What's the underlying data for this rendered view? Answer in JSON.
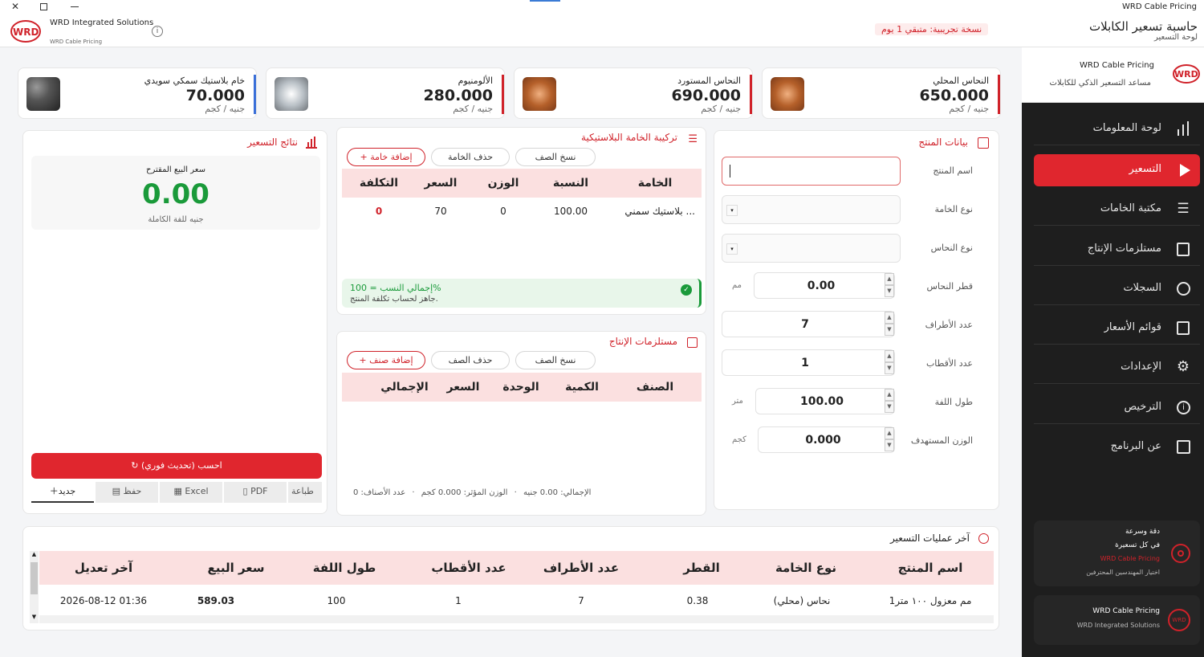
{
  "window": {
    "title": "WRD Cable Pricing"
  },
  "header": {
    "app_title": "حاسبة تسعير الكابلات",
    "app_subtitle": "لوحة التسعير",
    "trial_badge": "نسخة تجريبية: متبقي 1 يوم",
    "company_name": "WRD Integrated Solutions",
    "company_sub": "WRD Cable Pricing",
    "logo_text": "WRD"
  },
  "materials": [
    {
      "name": "النحاس المحلي",
      "price": "650.000",
      "unit": "جنيه / كجم"
    },
    {
      "name": "النحاس المستورد",
      "price": "690.000",
      "unit": "جنيه / كجم"
    },
    {
      "name": "الألومنيوم",
      "price": "280.000",
      "unit": "جنيه / كجم"
    },
    {
      "name": "خام بلاستيك سمكي سويدي",
      "price": "70.000",
      "unit": "جنيه / كجم"
    }
  ],
  "product": {
    "title": "بيانات المنتج",
    "fields": {
      "name_label": "اسم المنتج",
      "name_value": "",
      "material_label": "نوع الخامة",
      "copper_label": "نوع النحاس",
      "diameter_label": "قطر النحاس",
      "diameter_value": "0.00",
      "diameter_unit": "مم",
      "ends_label": "عدد الأطراف",
      "ends_value": "7",
      "poles_label": "عدد الأقطاب",
      "poles_value": "1",
      "length_label": "طول اللفة",
      "length_value": "100.00",
      "length_unit": "متر",
      "weight_label": "الوزن المستهدف",
      "weight_value": "0.000",
      "weight_unit": "كجم"
    }
  },
  "plastic": {
    "title": "تركيبة الخامة البلاستيكية",
    "btn_copy": "نسخ الصف",
    "btn_delete": "حذف الخامة",
    "btn_add": "+ إضافة خامة",
    "headers": [
      "الخامة",
      "النسبة",
      "الوزن",
      "السعر",
      "التكلفة"
    ],
    "rows": [
      [
        "بلاستيك سمني ...",
        "100.00",
        "0",
        "70",
        "0"
      ]
    ],
    "status_title": "إجمالي النسب = 100%",
    "status_sub": "جاهز لحساب تكلفة المنتج."
  },
  "supplies": {
    "title": "مستلزمات الإنتاج",
    "btn_copy": "نسخ الصف",
    "btn_delete": "حذف الصف",
    "btn_add": "+ إضافة صنف",
    "headers": [
      "الصنف",
      "الكمية",
      "الوحدة",
      "السعر",
      "الإجمالي"
    ],
    "footer_count": "عدد الأصناف: 0",
    "footer_weight": "الوزن المؤثر: 0.000 كجم",
    "footer_total": "الإجمالي: 0.00 جنيه",
    "sep": "·"
  },
  "results": {
    "title": "نتائج التسعير",
    "price_label": "سعر البيع المقترح",
    "price_value": "0.00",
    "price_unit": "جنيه للفة الكاملة",
    "calc_btn": "احسب (تحديث فوري)",
    "tabs": [
      "جديد",
      "حفظ",
      "Excel",
      "PDF",
      "طباعة"
    ]
  },
  "recent": {
    "title": "آخر عمليات التسعير",
    "headers": [
      "اسم المنتج",
      "نوع الخامة",
      "القطر",
      "عدد الأطراف",
      "عدد الأقطاب",
      "طول اللفة",
      "سعر البيع",
      "آخر تعديل"
    ],
    "rows": [
      [
        "1مم معزول ١٠٠ متر",
        "نحاس (محلي)",
        "0.38",
        "7",
        "1",
        "100",
        "589.03",
        "2026-08-12 01:36"
      ]
    ]
  },
  "sidebar": {
    "brand": "WRD Cable Pricing",
    "brand_sub": "مساعد التسعير الذكي للكابلات",
    "items": [
      {
        "label": "لوحة المعلومات",
        "icon": "bar-chart-icon"
      },
      {
        "label": "التسعير",
        "icon": "play-icon",
        "active": true
      },
      {
        "label": "مكتبة الخامات",
        "icon": "menu-icon"
      },
      {
        "label": "مستلزمات الإنتاج",
        "icon": "document-icon"
      },
      {
        "label": "السجلات",
        "icon": "clock-icon"
      },
      {
        "label": "قوائم الأسعار",
        "icon": "list-icon"
      },
      {
        "label": "الإعدادات",
        "icon": "gear-icon"
      },
      {
        "label": "الترخيص",
        "icon": "info-icon"
      },
      {
        "label": "عن البرنامج",
        "icon": "grid-icon"
      }
    ],
    "promo1": {
      "line1": "دقة وسرعة",
      "line2": "في كل تسعيرة",
      "line3": "WRD Cable Pricing",
      "line4": "اختيار المهندسين المحترفين"
    },
    "promo2": {
      "line1": "WRD Cable Pricing",
      "line2": "WRD Integrated Solutions"
    }
  },
  "colors": {
    "accent": "#d0222a",
    "sidebar": "#1e1e1e",
    "green": "#1a9a3a"
  }
}
